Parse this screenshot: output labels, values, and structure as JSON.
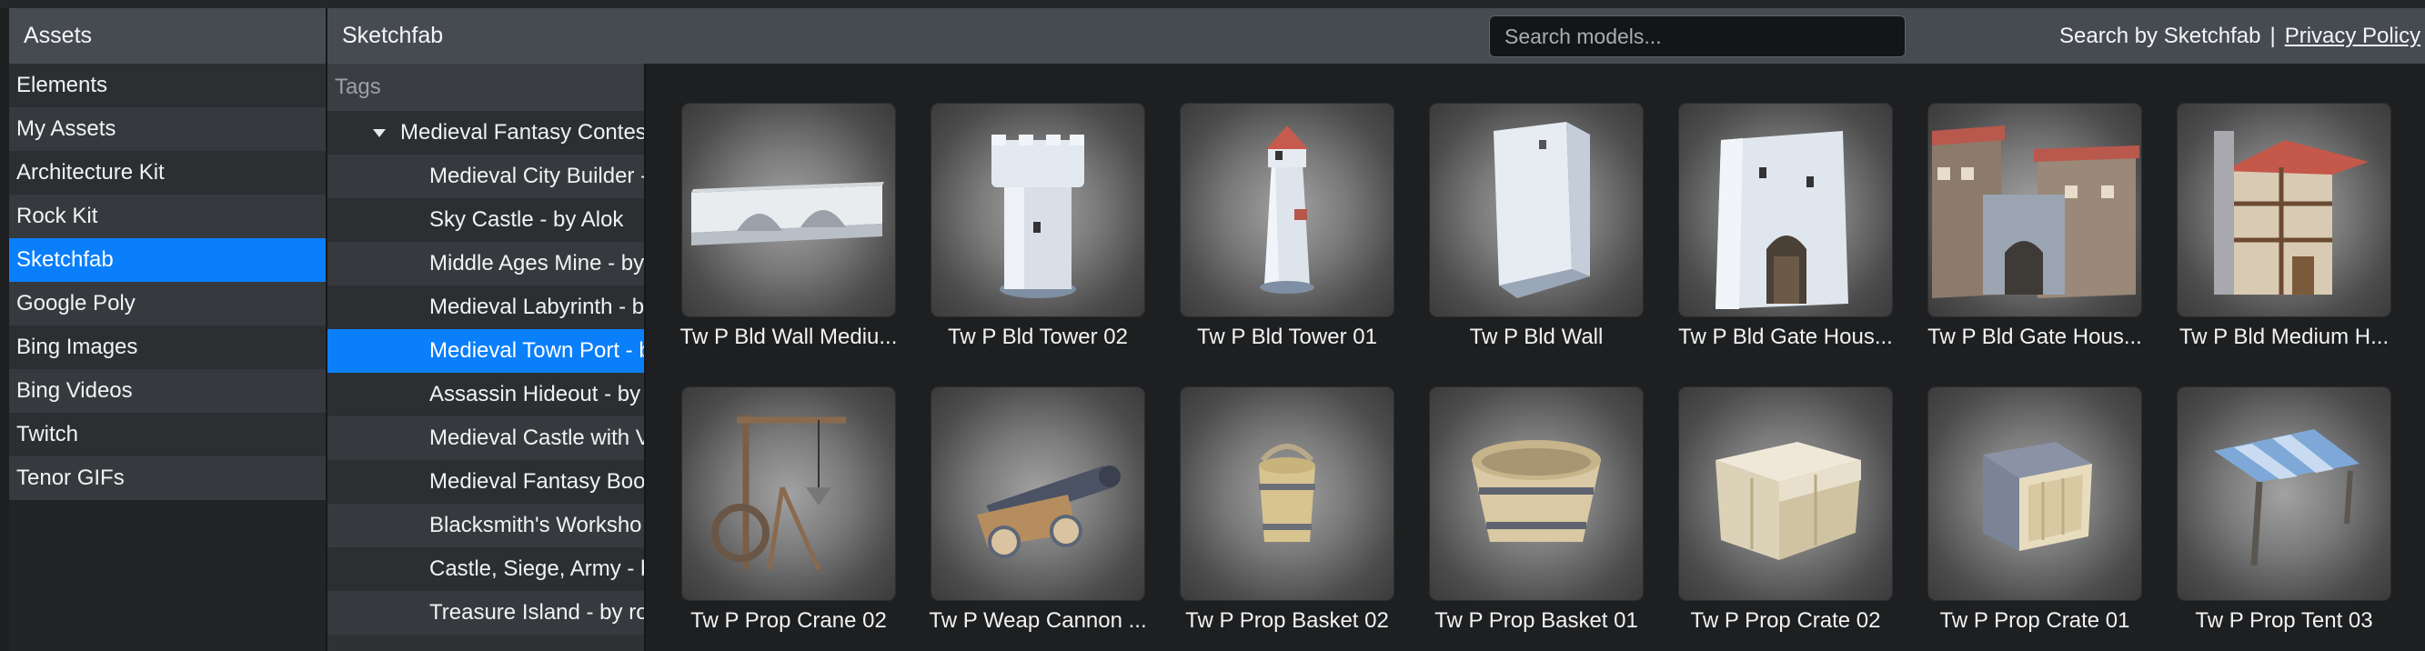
{
  "assets_panel": {
    "title": "Assets",
    "items": [
      {
        "label": "Elements"
      },
      {
        "label": "My Assets"
      },
      {
        "label": "Architecture Kit"
      },
      {
        "label": "Rock Kit"
      },
      {
        "label": "Sketchfab",
        "selected": true
      },
      {
        "label": "Google Poly"
      },
      {
        "label": "Bing Images"
      },
      {
        "label": "Bing Videos"
      },
      {
        "label": "Twitch"
      },
      {
        "label": "Tenor GIFs"
      }
    ]
  },
  "topbar": {
    "title": "Sketchfab",
    "search_placeholder": "Search models...",
    "search_value": "",
    "powered_by": "Search by Sketchfab",
    "separator": "|",
    "privacy_link": "Privacy Policy"
  },
  "tags_panel": {
    "header": "Tags",
    "group": "Medieval Fantasy Contest",
    "items": [
      {
        "label": "Medieval City Builder -"
      },
      {
        "label": "Sky Castle - by Alok"
      },
      {
        "label": "Middle Ages Mine - by"
      },
      {
        "label": "Medieval Labyrinth - by"
      },
      {
        "label": "Medieval Town Port - by",
        "selected": true
      },
      {
        "label": "Assassin Hideout - by r"
      },
      {
        "label": "Medieval Castle with V"
      },
      {
        "label": "Medieval Fantasy Bool"
      },
      {
        "label": "Blacksmith's Worksho"
      },
      {
        "label": "Castle, Siege, Army - by"
      },
      {
        "label": "Treasure Island - by rog"
      }
    ]
  },
  "models": [
    {
      "name": "Tw P Bld Wall Mediu...",
      "icon": "wall-model-icon"
    },
    {
      "name": "Tw P Bld Tower 02",
      "icon": "round-tower-model-icon"
    },
    {
      "name": "Tw P Bld Tower 01",
      "icon": "lighthouse-tower-model-icon"
    },
    {
      "name": "Tw P Bld Wall",
      "icon": "wall-tower-model-icon"
    },
    {
      "name": "Tw P Bld Gate Hous...",
      "icon": "gatehouse-model-icon"
    },
    {
      "name": "Tw P Bld Gate Hous...",
      "icon": "timber-gatehouse-model-icon"
    },
    {
      "name": "Tw P Bld Medium H...",
      "icon": "timber-house-model-icon"
    },
    {
      "name": "Tw P Prop Crane 02",
      "icon": "crane-model-icon"
    },
    {
      "name": "Tw P Weap Cannon ...",
      "icon": "cannon-model-icon"
    },
    {
      "name": "Tw P Prop Basket 02",
      "icon": "bucket-model-icon"
    },
    {
      "name": "Tw P Prop Basket 01",
      "icon": "tub-model-icon"
    },
    {
      "name": "Tw P Prop Crate 02",
      "icon": "covered-crate-model-icon"
    },
    {
      "name": "Tw P Prop Crate 01",
      "icon": "crate-model-icon"
    },
    {
      "name": "Tw P Prop Tent 03",
      "icon": "tent-model-icon"
    }
  ],
  "colors": {
    "accent": "#0a7ffb",
    "header": "#464b52",
    "background": "#1d1f21"
  }
}
